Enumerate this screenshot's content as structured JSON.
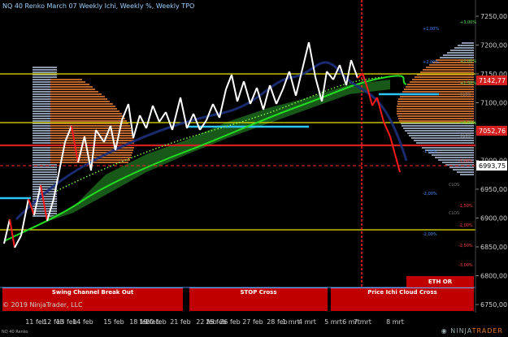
{
  "title": "NQ 40 Renko  March 07 Weekly  Ichi,  Weekly %, Weekly TPO",
  "copyright": "© 2019 NinjaTrader, LLC",
  "instrument_tag": "NQ 40 Renko",
  "brand": {
    "ninja": "NINJA",
    "trader": "TRADER"
  },
  "price_axis": {
    "ticks": [
      "7250,00",
      "7200,00",
      "7150,00",
      "7100,00",
      "7050,00",
      "7000,00",
      "6950,00",
      "6900,00",
      "6850,00",
      "6800,00",
      "6750,00"
    ],
    "markers": [
      {
        "label": "7142,77",
        "bg": "#d42020",
        "fg": "#ffffff"
      },
      {
        "label": "7052,76",
        "bg": "#d42020",
        "fg": "#ffffff"
      },
      {
        "label": "6993,75",
        "bg": "#ffffff",
        "fg": "#000000"
      }
    ]
  },
  "time_axis": [
    "11 feb",
    "12 feb",
    "13 feb",
    "14 feb",
    "15 feb",
    "18 feb",
    "19 feb",
    "20 feb",
    "21 feb",
    "22 feb",
    "25 feb",
    "26 feb",
    "27 feb",
    "28 feb",
    "1 mrt",
    "4 mrt",
    "5 mrt",
    "6 mrt",
    "7 mrt",
    "8 mrt"
  ],
  "pct_labels_blue": [
    "+1,00%",
    "+2,00%",
    "-1,00%",
    "-2,00%",
    "-2,00%"
  ],
  "pct_labels_green": [
    "+3,00%",
    "+2,00%",
    "+1,50%",
    "+1,00%"
  ],
  "pct_labels_red": [
    "-1,00%",
    "-1,50%",
    "-2,00%",
    "-2,50%",
    "-3,00%"
  ],
  "level_tags": [
    "CLOS",
    "CLOS",
    "CLOS",
    "CLOS"
  ],
  "banners": [
    {
      "label": "Swing Channel Break Out"
    },
    {
      "label": "STOP Cross"
    },
    {
      "label": "Price Ichi Cloud Cross"
    }
  ],
  "eth_label": "ETH OR",
  "colors": {
    "bull": "#ffffff",
    "bear": "#ff1a1a",
    "ema": "#22dd22",
    "kumo": "#1e6e1e",
    "cyan": "#2ec5ff",
    "yellow": "#e8e300",
    "red": "#d42020"
  }
}
